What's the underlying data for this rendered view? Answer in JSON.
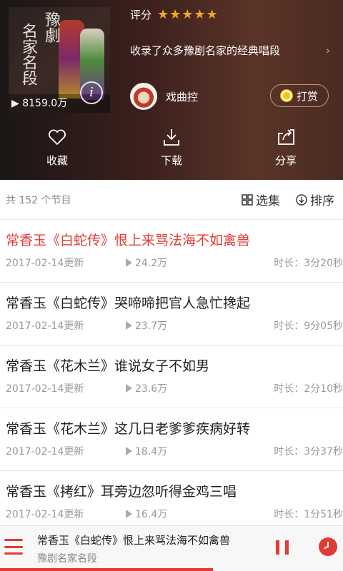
{
  "album": {
    "cover_title_right": "豫劇",
    "cover_title_left": "名家名段",
    "play_count": "8159.0万",
    "rating_label": "评分",
    "stars": "★★★★★",
    "description": "收录了众多豫剧名家的经典唱段",
    "anchor_name": "戏曲控",
    "tip_label": "打赏"
  },
  "actions": {
    "favorite": "收藏",
    "download": "下载",
    "share": "分享"
  },
  "list_header": {
    "count": "共 152 个节目",
    "select_label": "选集",
    "sort_label": "排序"
  },
  "tracks": [
    {
      "title": "常香玉《白蛇传》恨上来骂法海不如禽兽",
      "date": "2017-02-14更新",
      "plays": "24.2万",
      "duration": "时长：3分20秒"
    },
    {
      "title": "常香玉《白蛇传》哭啼啼把官人急忙搀起",
      "date": "2017-02-14更新",
      "plays": "23.7万",
      "duration": "时长：9分05秒"
    },
    {
      "title": "常香玉《花木兰》谁说女子不如男",
      "date": "2017-02-14更新",
      "plays": "23.6万",
      "duration": "时长：2分10秒"
    },
    {
      "title": "常香玉《花木兰》这几日老爹爹疾病好转",
      "date": "2017-02-14更新",
      "plays": "18.4万",
      "duration": "时长：3分37秒"
    },
    {
      "title": "常香玉《拷红》耳旁边忽听得金鸡三唱",
      "date": "2017-02-14更新",
      "plays": "16.4万",
      "duration": "时长：1分51秒"
    }
  ],
  "player": {
    "title": "常香玉《白蛇传》恨上来骂法海不如禽兽",
    "album": "豫剧名家名段",
    "progress": 0.62
  },
  "colors": {
    "accent": "#e23b34",
    "star": "#f5a623"
  }
}
